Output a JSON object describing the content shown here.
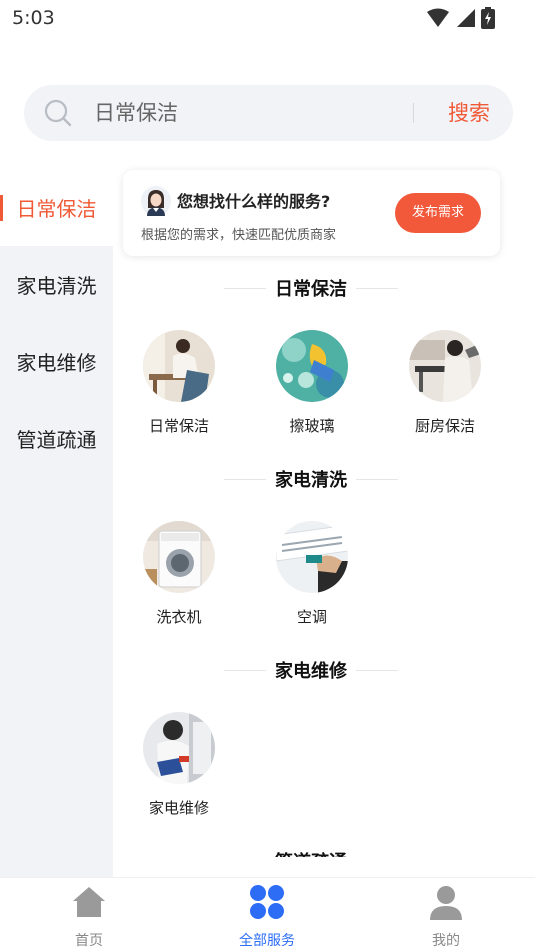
{
  "status": {
    "time": "5:03"
  },
  "search": {
    "placeholder": "日常保洁",
    "button": "搜索"
  },
  "sidebar": {
    "items": [
      {
        "label": "日常保洁",
        "active": true
      },
      {
        "label": "家电清洗",
        "active": false
      },
      {
        "label": "家电维修",
        "active": false
      },
      {
        "label": "管道疏通",
        "active": false
      }
    ]
  },
  "promo": {
    "title": "您想找什么样的服务?",
    "subtitle": "根据您的需求，快速匹配优质商家",
    "button": "发布需求"
  },
  "sections": [
    {
      "title": "日常保洁",
      "items": [
        {
          "label": "日常保洁"
        },
        {
          "label": "擦玻璃"
        },
        {
          "label": "厨房保洁"
        }
      ]
    },
    {
      "title": "家电清洗",
      "items": [
        {
          "label": "洗衣机"
        },
        {
          "label": "空调"
        }
      ]
    },
    {
      "title": "家电维修",
      "items": [
        {
          "label": "家电维修"
        }
      ]
    },
    {
      "title": "管道疏通",
      "items": []
    }
  ],
  "bottom_nav": {
    "items": [
      {
        "label": "首页",
        "icon": "home-icon",
        "active": false
      },
      {
        "label": "全部服务",
        "icon": "grid-icon",
        "active": true
      },
      {
        "label": "我的",
        "icon": "person-icon",
        "active": false
      }
    ]
  },
  "colors": {
    "accent": "#f05a36",
    "nav_active": "#2d6df6",
    "sidebar_bg": "#f2f3f7"
  }
}
